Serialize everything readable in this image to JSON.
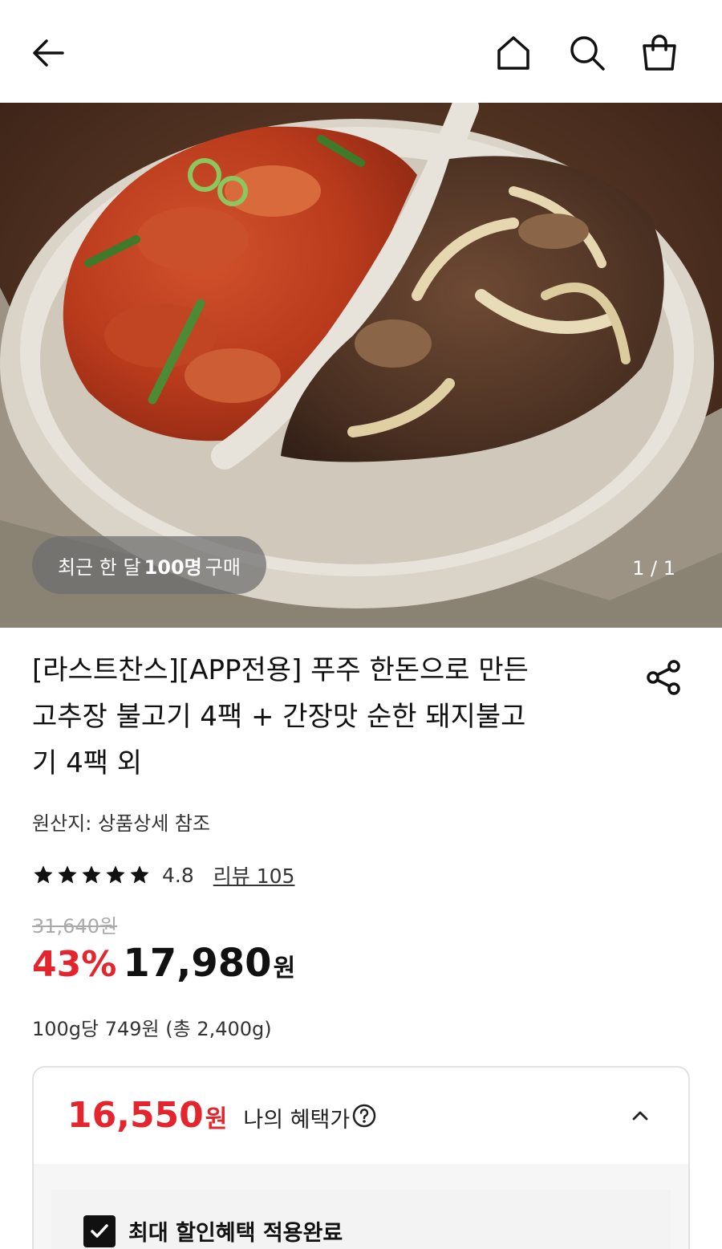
{
  "nav": {
    "back_icon": "back-arrow-icon",
    "home_icon": "home-icon",
    "search_icon": "search-icon",
    "cart_icon": "shopping-bag-icon"
  },
  "hero": {
    "badge_prefix": "최근 한 달",
    "badge_count": "100명",
    "badge_suffix": "구매",
    "pager": "1 / 1"
  },
  "product": {
    "title_line1": "[라스트찬스][APP전용] 푸주 한돈으로 만든",
    "title_line2": "고추장 불고기 4팩 + 간장맛 순한 돼지불고",
    "title_line3": "기 4팩 외",
    "origin": "원산지: 상품상세 참조",
    "rating": "4.8",
    "stars": 5,
    "review_link": "리뷰 105",
    "original_price": "31,640원",
    "discount": "43%",
    "price": "17,980",
    "price_unit": "원",
    "unit_price": "100g당 749원 (총 2,400g)"
  },
  "benefit": {
    "price": "16,550",
    "price_unit": "원",
    "label": "나의 혜택가",
    "applied_label": "최대 할인혜택 적용완료"
  },
  "colors": {
    "accent": "#e4252d",
    "text": "#111111"
  }
}
